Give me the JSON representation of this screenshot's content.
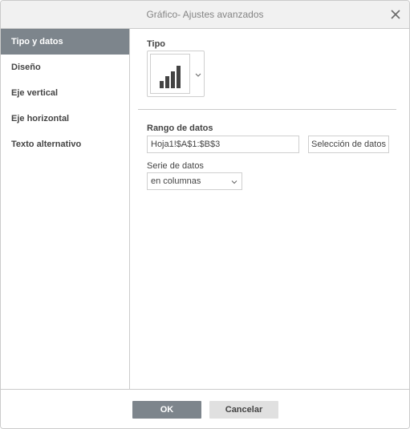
{
  "dialog": {
    "title": "Gráfico- Ajustes avanzados"
  },
  "sidebar": {
    "items": [
      {
        "label": "Tipo y datos",
        "active": true
      },
      {
        "label": "Diseño",
        "active": false
      },
      {
        "label": "Eje vertical",
        "active": false
      },
      {
        "label": "Eje horizontal",
        "active": false
      },
      {
        "label": "Texto alternativo",
        "active": false
      }
    ]
  },
  "content": {
    "type_label": "Tipo",
    "type_icon": "column-chart-icon",
    "data_range_label": "Rango de datos",
    "data_range_value": "Hoja1!$A$1:$B$3",
    "select_data_button": "Selección de datos",
    "data_series_label": "Serie de datos",
    "data_series_value": "en columnas"
  },
  "footer": {
    "ok_label": "OK",
    "cancel_label": "Cancelar"
  },
  "colors": {
    "active_background": "#7d858c",
    "border": "#cbcbcb",
    "title_text": "#848484"
  }
}
